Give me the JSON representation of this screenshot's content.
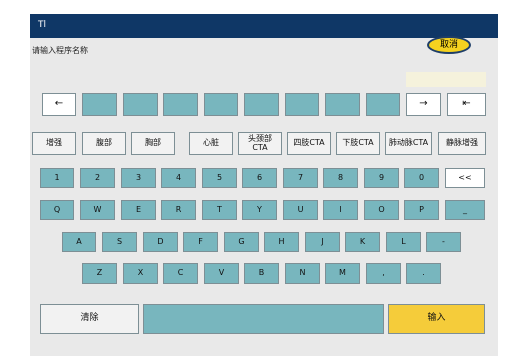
{
  "window": {
    "title": "Tl"
  },
  "header": {
    "cancel_label": "取消"
  },
  "prompt": {
    "label": "请输入程序名称"
  },
  "name_field": {
    "value": ""
  },
  "nav_row": {
    "left_arrow": "←",
    "right_arrow": "→",
    "delete": "⇤"
  },
  "protocols": [
    "增强",
    "腹部",
    "胸部",
    "心脏",
    "头颈部\nCTA",
    "四肢CTA",
    "下肢CTA",
    "肺动脉CTA",
    "静脉增强"
  ],
  "numbers": [
    "1",
    "2",
    "3",
    "4",
    "5",
    "6",
    "7",
    "8",
    "9",
    "0",
    "<<"
  ],
  "row_q": [
    "Q",
    "W",
    "E",
    "R",
    "T",
    "Y",
    "U",
    "I",
    "O",
    "P",
    "_"
  ],
  "row_a": [
    "A",
    "S",
    "D",
    "F",
    "G",
    "H",
    "J",
    "K",
    "L",
    "-"
  ],
  "row_z": [
    "Z",
    "X",
    "C",
    "V",
    "B",
    "N",
    "M",
    ",",
    "."
  ],
  "bottom": {
    "clear_label": "清除",
    "space_label": "",
    "enter_label": "输入"
  },
  "colors": {
    "title_bar": "#0f3766",
    "key": "#78b6be",
    "accent": "#f5cc3a"
  }
}
